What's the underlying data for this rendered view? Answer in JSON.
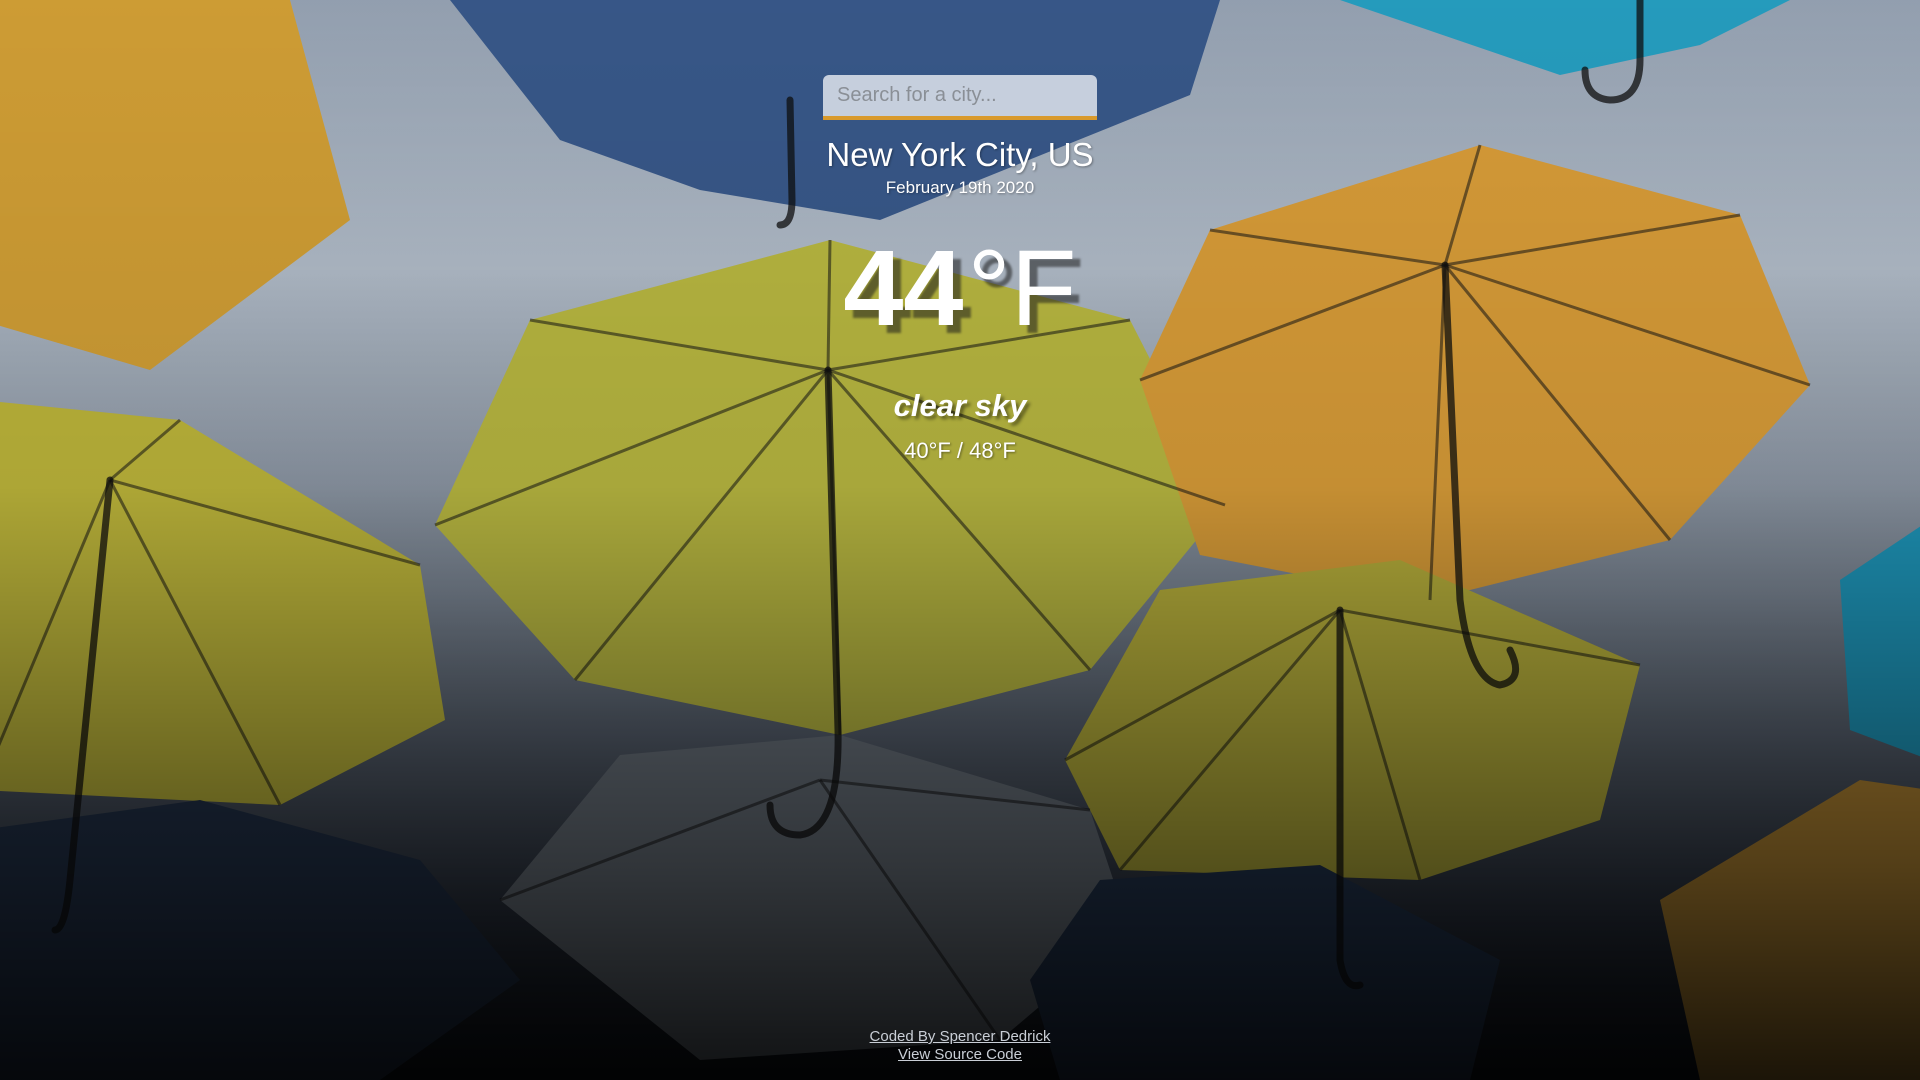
{
  "search": {
    "placeholder": "Search for a city...",
    "value": ""
  },
  "location": {
    "city": "New York City, US",
    "date": "February 19th 2020"
  },
  "weather": {
    "temperature": "44",
    "unit": "°F",
    "description": "clear sky",
    "low_high": "40°F / 48°F"
  },
  "footer": {
    "credit_link": "Coded By Spencer Dedrick",
    "source_link": "View Source Code"
  },
  "background": {
    "subject": "umbrellas",
    "colors": {
      "sky": "#b7c2cf",
      "yellow": "#c9c23a",
      "orange": "#e2a53a",
      "blue": "#2e4f86",
      "teal": "#1f9bc0"
    }
  },
  "colors": {
    "accent": "#d99a2b",
    "text": "#ffffff",
    "footer_link": "#c9ced6"
  }
}
